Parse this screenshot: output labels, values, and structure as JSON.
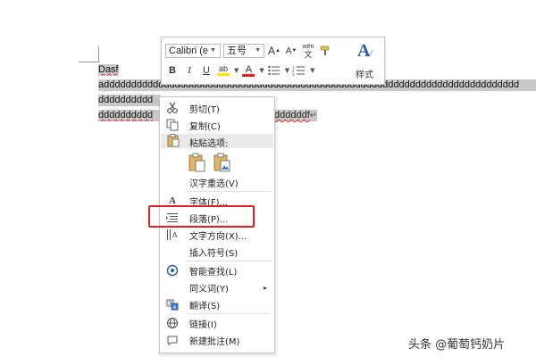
{
  "document": {
    "line1": "Dasf",
    "line2": "adddddddddddddddddddddddddddddddddddddddddddddddddddddddddddddddddddddddddddd",
    "line3": "dddddddddd",
    "line4_left": "dddddddddd",
    "line4_right": "ddddddf"
  },
  "toolbar": {
    "font_name": "Calibri (е",
    "font_size": "五号",
    "grow_font": "A",
    "shrink_font": "A",
    "phonetic": "ṽén",
    "bold": "B",
    "italic": "I",
    "underline": "U",
    "highlight": "ab",
    "font_color": "A",
    "styles_label": "样式",
    "accent_color": "#2a5caa"
  },
  "menu": {
    "items": [
      {
        "label": "剪切(T)",
        "icon": "scissors-icon"
      },
      {
        "label": "复制(C)",
        "icon": "copy-icon"
      },
      {
        "label": "粘贴选项:",
        "icon": "paste-icon"
      },
      {
        "label": "汉字重选(V)"
      },
      {
        "label": "字体(F)...",
        "icon": "font-icon"
      },
      {
        "label": "段落(P)...",
        "icon": "paragraph-icon"
      },
      {
        "label": "文字方向(X)...",
        "icon": "text-direction-icon"
      },
      {
        "label": "插入符号(S)"
      },
      {
        "label": "智能查找(L)",
        "icon": "smart-lookup-icon"
      },
      {
        "label": "同义词(Y)",
        "submenu": "▸"
      },
      {
        "label": "翻译(S)",
        "icon": "translate-icon"
      },
      {
        "label": "链接(I)",
        "icon": "link-icon"
      },
      {
        "label": "新建批注(M)",
        "icon": "new-comment-icon"
      }
    ],
    "highlight_color": "#e02020"
  },
  "watermark": "头条 @葡萄钙奶片"
}
